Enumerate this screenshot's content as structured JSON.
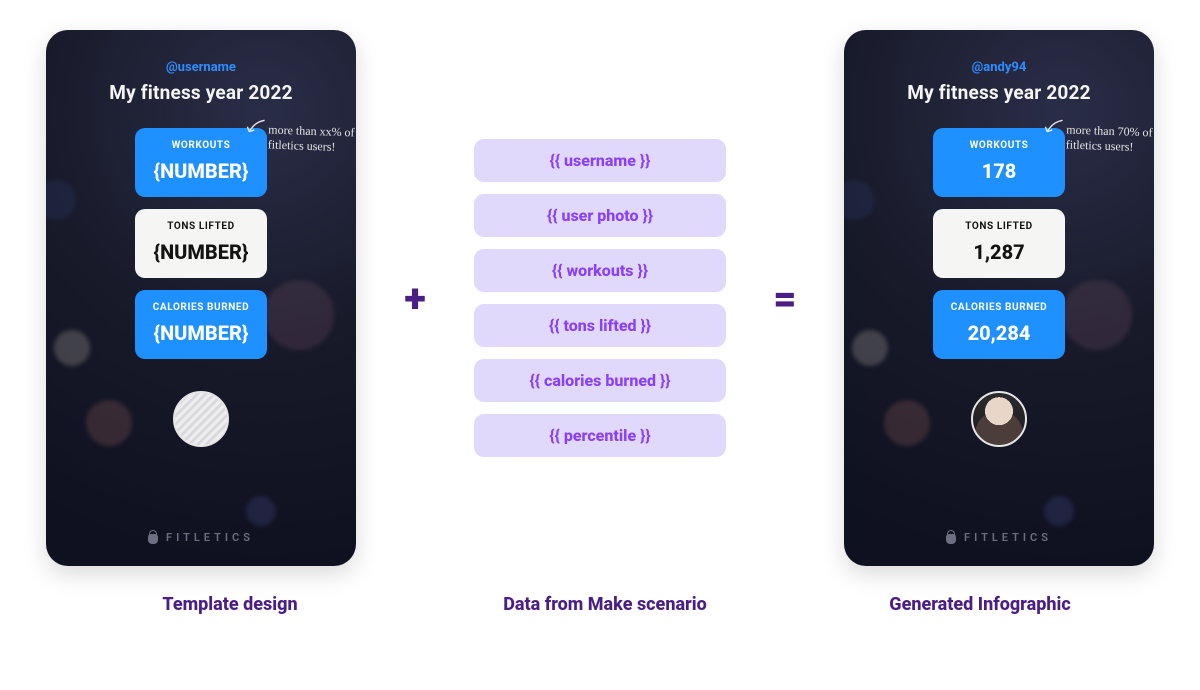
{
  "template_card": {
    "username": "@username",
    "title": "My fitness year 2022",
    "workouts_label": "WORKOUTS",
    "workouts_value": "{NUMBER}",
    "tons_label": "TONS LIFTED",
    "tons_value": "{NUMBER}",
    "calories_label": "CALORIES BURNED",
    "calories_value": "{NUMBER}",
    "annotation": "more than xx% of fitletics users!",
    "brand": "FITLETICS"
  },
  "generated_card": {
    "username": "@andy94",
    "title": "My fitness year 2022",
    "workouts_label": "WORKOUTS",
    "workouts_value": "178",
    "tons_label": "TONS LIFTED",
    "tons_value": "1,287",
    "calories_label": "CALORIES BURNED",
    "calories_value": "20,284",
    "annotation": "more than 70% of fitletics users!",
    "brand": "FITLETICS"
  },
  "data_pills": [
    "{{ username }}",
    "{{ user photo }}",
    "{{ workouts }}",
    "{{ tons lifted }}",
    "{{ calories burned }}",
    "{{ percentile }}"
  ],
  "operators": {
    "plus": "+",
    "equals": "="
  },
  "captions": {
    "left": "Template design",
    "mid": "Data from Make scenario",
    "right": "Generated Infographic"
  }
}
